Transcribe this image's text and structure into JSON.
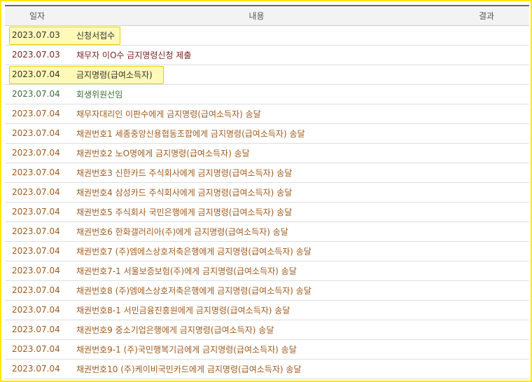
{
  "header": {
    "date": "일자",
    "content": "내용",
    "result": "결과"
  },
  "colors": {
    "highlight_border": "#e8cf00",
    "highlight_fill": "#fffab8",
    "frame": "#ffe600"
  },
  "rows": [
    {
      "date": "2023.07.03",
      "content": "신청서접수",
      "color": "dark",
      "highlight": true
    },
    {
      "date": "2023.07.03",
      "content": "채무자 이O수 금지명령신청 제출",
      "color": "maroon",
      "highlight": false
    },
    {
      "date": "2023.07.04",
      "content": "금지명령(급여소득자)",
      "color": "dark",
      "highlight": true
    },
    {
      "date": "2023.07.04",
      "content": "회생위원선임",
      "color": "green",
      "highlight": false
    },
    {
      "date": "2023.07.04",
      "content": "채무자대리인 이판수에게 금지명령(급여소득자) 송달",
      "color": "orange",
      "highlight": false
    },
    {
      "date": "2023.07.04",
      "content": "채권번호1 세종중앙신용협동조합에게 금지명령(급여소득자) 송달",
      "color": "orange",
      "highlight": false
    },
    {
      "date": "2023.07.04",
      "content": "채권번호2 노O명에게 금지명령(급여소득자) 송달",
      "color": "orange",
      "highlight": false
    },
    {
      "date": "2023.07.04",
      "content": "채권번호3 신한카드 주식회사에게 금지명령(급여소득자) 송달",
      "color": "orange",
      "highlight": false
    },
    {
      "date": "2023.07.04",
      "content": "채권번호4 삼성카드 주식회사에게 금지명령(급여소득자) 송달",
      "color": "orange",
      "highlight": false
    },
    {
      "date": "2023.07.04",
      "content": "채권번호5 주식회사 국민은행에게 금지명령(급여소득자) 송달",
      "color": "orange",
      "highlight": false
    },
    {
      "date": "2023.07.04",
      "content": "채권번호6 한화갤러리아(주)에게 금지명령(급여소득자) 송달",
      "color": "orange",
      "highlight": false
    },
    {
      "date": "2023.07.04",
      "content": "채권번호7 (주)엠에스상호저축은행에게 금지명령(급여소득자) 송달",
      "color": "orange",
      "highlight": false
    },
    {
      "date": "2023.07.04",
      "content": "채권번호7-1 서울보증보험(주)에게 금지명령(급여소득자) 송달",
      "color": "orange",
      "highlight": false
    },
    {
      "date": "2023.07.04",
      "content": "채권번호8 (주)엠에스상호저축은행에게 금지명령(급여소득자) 송달",
      "color": "orange",
      "highlight": false
    },
    {
      "date": "2023.07.04",
      "content": "채권번호8-1 서민금융진흥원에게 금지명령(급여소득자) 송달",
      "color": "orange",
      "highlight": false
    },
    {
      "date": "2023.07.04",
      "content": "채권번호9 중소기업은행에게 금지명령(급여소득자) 송달",
      "color": "orange",
      "highlight": false
    },
    {
      "date": "2023.07.04",
      "content": "채권번호9-1 (주)국민행복기금에게 금지명령(급여소득자) 송달",
      "color": "orange",
      "highlight": false
    },
    {
      "date": "2023.07.04",
      "content": "채권번호10 (주)케이비국민카드에게 금지명령(급여소득자) 송달",
      "color": "orange",
      "highlight": false
    }
  ]
}
